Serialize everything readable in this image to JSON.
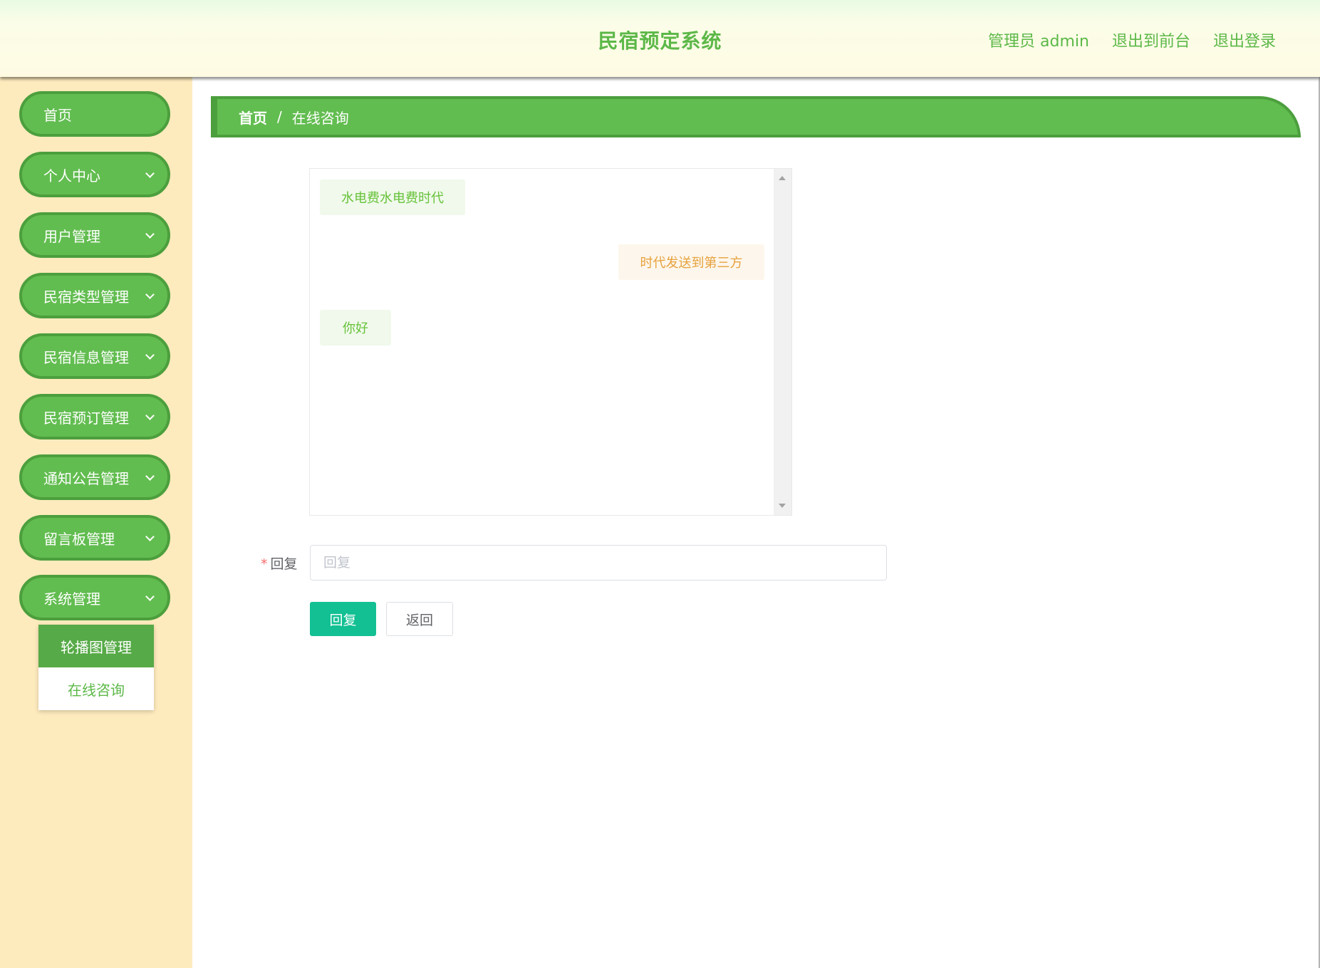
{
  "header": {
    "title": "民宿预定系统",
    "user": "管理员 admin",
    "to_front": "退出到前台",
    "logout": "退出登录"
  },
  "sidebar": {
    "items": [
      {
        "label": "首页"
      },
      {
        "label": "个人中心"
      },
      {
        "label": "用户管理"
      },
      {
        "label": "民宿类型管理"
      },
      {
        "label": "民宿信息管理"
      },
      {
        "label": "民宿预订管理"
      },
      {
        "label": "通知公告管理"
      },
      {
        "label": "留言板管理"
      },
      {
        "label": "系统管理"
      }
    ],
    "submenu": [
      {
        "label": "轮播图管理"
      },
      {
        "label": "在线咨询"
      }
    ]
  },
  "breadcrumb": {
    "home": "首页",
    "separator": "/",
    "current": "在线咨询"
  },
  "chat": {
    "messages": [
      {
        "side": "left",
        "text": "水电费水电费时代"
      },
      {
        "side": "right",
        "text": "时代发送到第三方"
      },
      {
        "side": "left",
        "text": "你好"
      }
    ]
  },
  "form": {
    "required_mark": "*",
    "label": "回复",
    "placeholder": "回复",
    "value": "",
    "submit_label": "回复",
    "back_label": "返回"
  },
  "colors": {
    "primary_green": "#62bd50",
    "green_border": "#4c9f3d",
    "sidebar_bg": "#feebbd",
    "submit_button": "#13c093"
  }
}
